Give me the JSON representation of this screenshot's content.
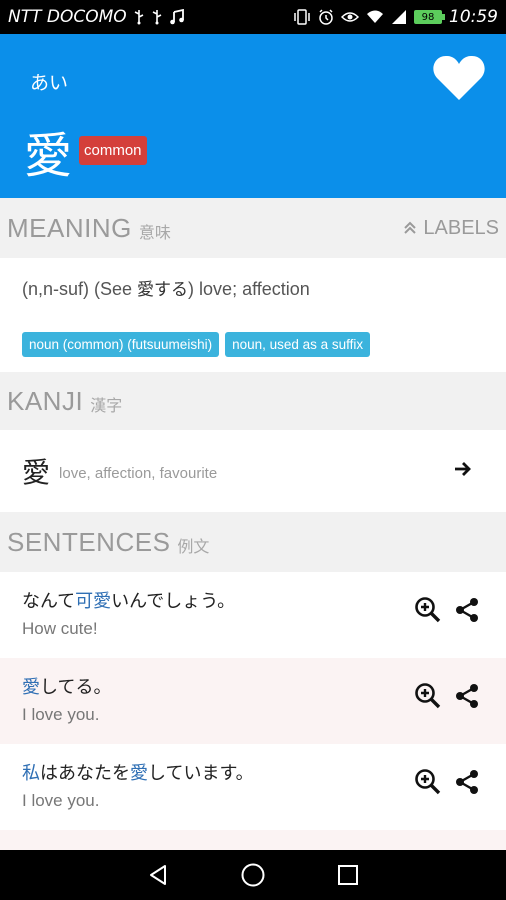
{
  "status_bar": {
    "carrier": "NTT DOCOMO",
    "battery": "98",
    "time": "10:59"
  },
  "header": {
    "reading": "あい",
    "word": "愛",
    "badge": "common",
    "favorite_icon": "heart-icon"
  },
  "meaning_section": {
    "title": "MEANING",
    "subtitle": "意味",
    "labels_toggle": "LABELS",
    "definition_prefix": "(n,n-suf) (See ",
    "definition_jp": "愛する",
    "definition_suffix": ") love; affection",
    "tags": [
      "noun (common) (futsuumeishi)",
      "noun, used as a suffix"
    ]
  },
  "kanji_section": {
    "title": "KANJI",
    "subtitle": "漢字",
    "kanji": "愛",
    "kanji_meaning": "love, affection, favourite"
  },
  "sentences_section": {
    "title": "SENTENCES",
    "subtitle": "例文",
    "items": [
      {
        "jp_before": "なんて",
        "jp_highlight": "可愛",
        "jp_after": "いんでしょう。",
        "en": "How cute!"
      },
      {
        "jp_before": "",
        "jp_highlight": "愛",
        "jp_after": "してる。",
        "en": "I love you."
      },
      {
        "jp_before": "",
        "jp_highlight": "私",
        "jp_mid": "はあなたを",
        "jp_highlight2": "愛",
        "jp_after": "しています。",
        "en": "I love you."
      }
    ]
  },
  "colors": {
    "header_blue": "#0b8fea",
    "common_badge": "#d43f3a",
    "tag_blue": "#3bb3dd",
    "highlight_text": "#2f6fb4"
  }
}
